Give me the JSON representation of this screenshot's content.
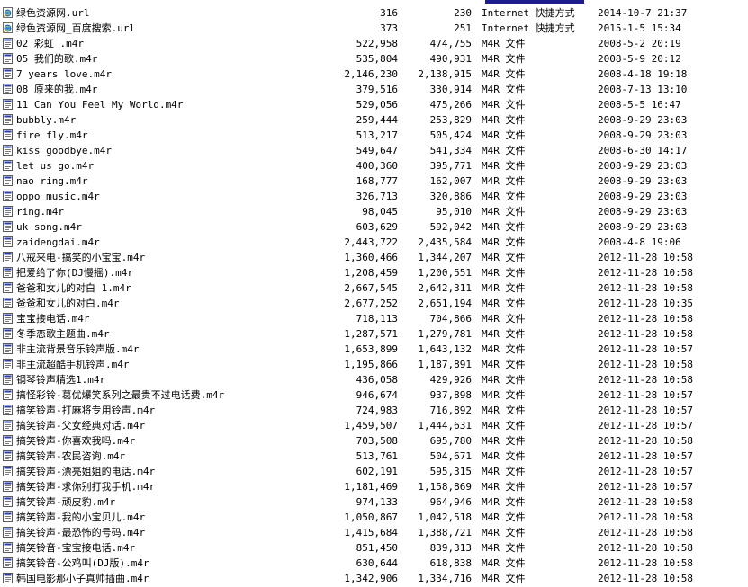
{
  "files": [
    {
      "name": "绿色资源网.url",
      "size": "316",
      "packed": "230",
      "type": "Internet 快捷方式",
      "modified": "2014-10-7 21:37",
      "icon": "url-shortcut-icon"
    },
    {
      "name": "绿色资源网_百度搜索.url",
      "size": "373",
      "packed": "251",
      "type": "Internet 快捷方式",
      "modified": "2015-1-5 15:34",
      "icon": "url-shortcut-icon"
    },
    {
      "name": "02 彩虹 .m4r",
      "size": "522,958",
      "packed": "474,755",
      "type": "M4R 文件",
      "modified": "2008-5-2 20:19",
      "icon": "m4r-file-icon"
    },
    {
      "name": "05 我们的歌.m4r",
      "size": "535,804",
      "packed": "490,931",
      "type": "M4R 文件",
      "modified": "2008-5-9 20:12",
      "icon": "m4r-file-icon"
    },
    {
      "name": "7 years love.m4r",
      "size": "2,146,230",
      "packed": "2,138,915",
      "type": "M4R 文件",
      "modified": "2008-4-18 19:18",
      "icon": "m4r-file-icon"
    },
    {
      "name": "08 原来的我.m4r",
      "size": "379,516",
      "packed": "330,914",
      "type": "M4R 文件",
      "modified": "2008-7-13 13:10",
      "icon": "m4r-file-icon"
    },
    {
      "name": "11 Can You Feel My World.m4r",
      "size": "529,056",
      "packed": "475,266",
      "type": "M4R 文件",
      "modified": "2008-5-5 16:47",
      "icon": "m4r-file-icon"
    },
    {
      "name": "bubbly.m4r",
      "size": "259,444",
      "packed": "253,829",
      "type": "M4R 文件",
      "modified": "2008-9-29 23:03",
      "icon": "m4r-file-icon"
    },
    {
      "name": "fire fly.m4r",
      "size": "513,217",
      "packed": "505,424",
      "type": "M4R 文件",
      "modified": "2008-9-29 23:03",
      "icon": "m4r-file-icon"
    },
    {
      "name": "kiss goodbye.m4r",
      "size": "549,647",
      "packed": "541,334",
      "type": "M4R 文件",
      "modified": "2008-6-30 14:17",
      "icon": "m4r-file-icon"
    },
    {
      "name": "let us go.m4r",
      "size": "400,360",
      "packed": "395,771",
      "type": "M4R 文件",
      "modified": "2008-9-29 23:03",
      "icon": "m4r-file-icon"
    },
    {
      "name": "nao ring.m4r",
      "size": "168,777",
      "packed": "162,007",
      "type": "M4R 文件",
      "modified": "2008-9-29 23:03",
      "icon": "m4r-file-icon"
    },
    {
      "name": "oppo music.m4r",
      "size": "326,713",
      "packed": "320,886",
      "type": "M4R 文件",
      "modified": "2008-9-29 23:03",
      "icon": "m4r-file-icon"
    },
    {
      "name": "ring.m4r",
      "size": "98,045",
      "packed": "95,010",
      "type": "M4R 文件",
      "modified": "2008-9-29 23:03",
      "icon": "m4r-file-icon"
    },
    {
      "name": "uk song.m4r",
      "size": "603,629",
      "packed": "592,042",
      "type": "M4R 文件",
      "modified": "2008-9-29 23:03",
      "icon": "m4r-file-icon"
    },
    {
      "name": "zaidengdai.m4r",
      "size": "2,443,722",
      "packed": "2,435,584",
      "type": "M4R 文件",
      "modified": "2008-4-8 19:06",
      "icon": "m4r-file-icon"
    },
    {
      "name": "八戒来电-搞笑的小宝宝.m4r",
      "size": "1,360,466",
      "packed": "1,344,207",
      "type": "M4R 文件",
      "modified": "2012-11-28 10:58",
      "icon": "m4r-file-icon"
    },
    {
      "name": "把爱给了你(DJ慢摇).m4r",
      "size": "1,208,459",
      "packed": "1,200,551",
      "type": "M4R 文件",
      "modified": "2012-11-28 10:58",
      "icon": "m4r-file-icon"
    },
    {
      "name": "爸爸和女儿的对白 1.m4r",
      "size": "2,667,545",
      "packed": "2,642,311",
      "type": "M4R 文件",
      "modified": "2012-11-28 10:58",
      "icon": "m4r-file-icon"
    },
    {
      "name": "爸爸和女儿的对白.m4r",
      "size": "2,677,252",
      "packed": "2,651,194",
      "type": "M4R 文件",
      "modified": "2012-11-28 10:35",
      "icon": "m4r-file-icon"
    },
    {
      "name": "宝宝接电话.m4r",
      "size": "718,113",
      "packed": "704,866",
      "type": "M4R 文件",
      "modified": "2012-11-28 10:58",
      "icon": "m4r-file-icon"
    },
    {
      "name": "冬季恋歌主题曲.m4r",
      "size": "1,287,571",
      "packed": "1,279,781",
      "type": "M4R 文件",
      "modified": "2012-11-28 10:58",
      "icon": "m4r-file-icon"
    },
    {
      "name": "非主流背景音乐铃声版.m4r",
      "size": "1,653,899",
      "packed": "1,643,132",
      "type": "M4R 文件",
      "modified": "2012-11-28 10:57",
      "icon": "m4r-file-icon"
    },
    {
      "name": "非主流超酷手机铃声.m4r",
      "size": "1,195,866",
      "packed": "1,187,891",
      "type": "M4R 文件",
      "modified": "2012-11-28 10:58",
      "icon": "m4r-file-icon"
    },
    {
      "name": "钢琴铃声精选1.m4r",
      "size": "436,058",
      "packed": "429,926",
      "type": "M4R 文件",
      "modified": "2012-11-28 10:58",
      "icon": "m4r-file-icon"
    },
    {
      "name": "搞怪彩铃-葛优爆笑系列之最贵不过电话费.m4r",
      "size": "946,674",
      "packed": "937,898",
      "type": "M4R 文件",
      "modified": "2012-11-28 10:57",
      "icon": "m4r-file-icon"
    },
    {
      "name": "搞笑铃声-打麻将专用铃声.m4r",
      "size": "724,983",
      "packed": "716,892",
      "type": "M4R 文件",
      "modified": "2012-11-28 10:57",
      "icon": "m4r-file-icon"
    },
    {
      "name": "搞笑铃声-父女经典对话.m4r",
      "size": "1,459,507",
      "packed": "1,444,631",
      "type": "M4R 文件",
      "modified": "2012-11-28 10:57",
      "icon": "m4r-file-icon"
    },
    {
      "name": "搞笑铃声-你喜欢我吗.m4r",
      "size": "703,508",
      "packed": "695,780",
      "type": "M4R 文件",
      "modified": "2012-11-28 10:58",
      "icon": "m4r-file-icon"
    },
    {
      "name": "搞笑铃声-农民咨询.m4r",
      "size": "513,761",
      "packed": "504,671",
      "type": "M4R 文件",
      "modified": "2012-11-28 10:57",
      "icon": "m4r-file-icon"
    },
    {
      "name": "搞笑铃声-漂亮姐姐的电话.m4r",
      "size": "602,191",
      "packed": "595,315",
      "type": "M4R 文件",
      "modified": "2012-11-28 10:57",
      "icon": "m4r-file-icon"
    },
    {
      "name": "搞笑铃声-求你别打我手机.m4r",
      "size": "1,181,469",
      "packed": "1,158,869",
      "type": "M4R 文件",
      "modified": "2012-11-28 10:57",
      "icon": "m4r-file-icon"
    },
    {
      "name": "搞笑铃声-顽皮豹.m4r",
      "size": "974,133",
      "packed": "964,946",
      "type": "M4R 文件",
      "modified": "2012-11-28 10:58",
      "icon": "m4r-file-icon"
    },
    {
      "name": "搞笑铃声-我的小宝贝儿.m4r",
      "size": "1,050,867",
      "packed": "1,042,518",
      "type": "M4R 文件",
      "modified": "2012-11-28 10:58",
      "icon": "m4r-file-icon"
    },
    {
      "name": "搞笑铃声-最恐怖的号码.m4r",
      "size": "1,415,684",
      "packed": "1,388,721",
      "type": "M4R 文件",
      "modified": "2012-11-28 10:58",
      "icon": "m4r-file-icon"
    },
    {
      "name": "搞笑铃音-宝宝接电话.m4r",
      "size": "851,450",
      "packed": "839,313",
      "type": "M4R 文件",
      "modified": "2012-11-28 10:58",
      "icon": "m4r-file-icon"
    },
    {
      "name": "搞笑铃音-公鸡叫(DJ版).m4r",
      "size": "630,644",
      "packed": "618,838",
      "type": "M4R 文件",
      "modified": "2012-11-28 10:58",
      "icon": "m4r-file-icon"
    },
    {
      "name": "韩国电影那小子真帅插曲.m4r",
      "size": "1,342,906",
      "packed": "1,334,716",
      "type": "M4R 文件",
      "modified": "2012-11-28 10:58",
      "icon": "m4r-file-icon"
    }
  ]
}
